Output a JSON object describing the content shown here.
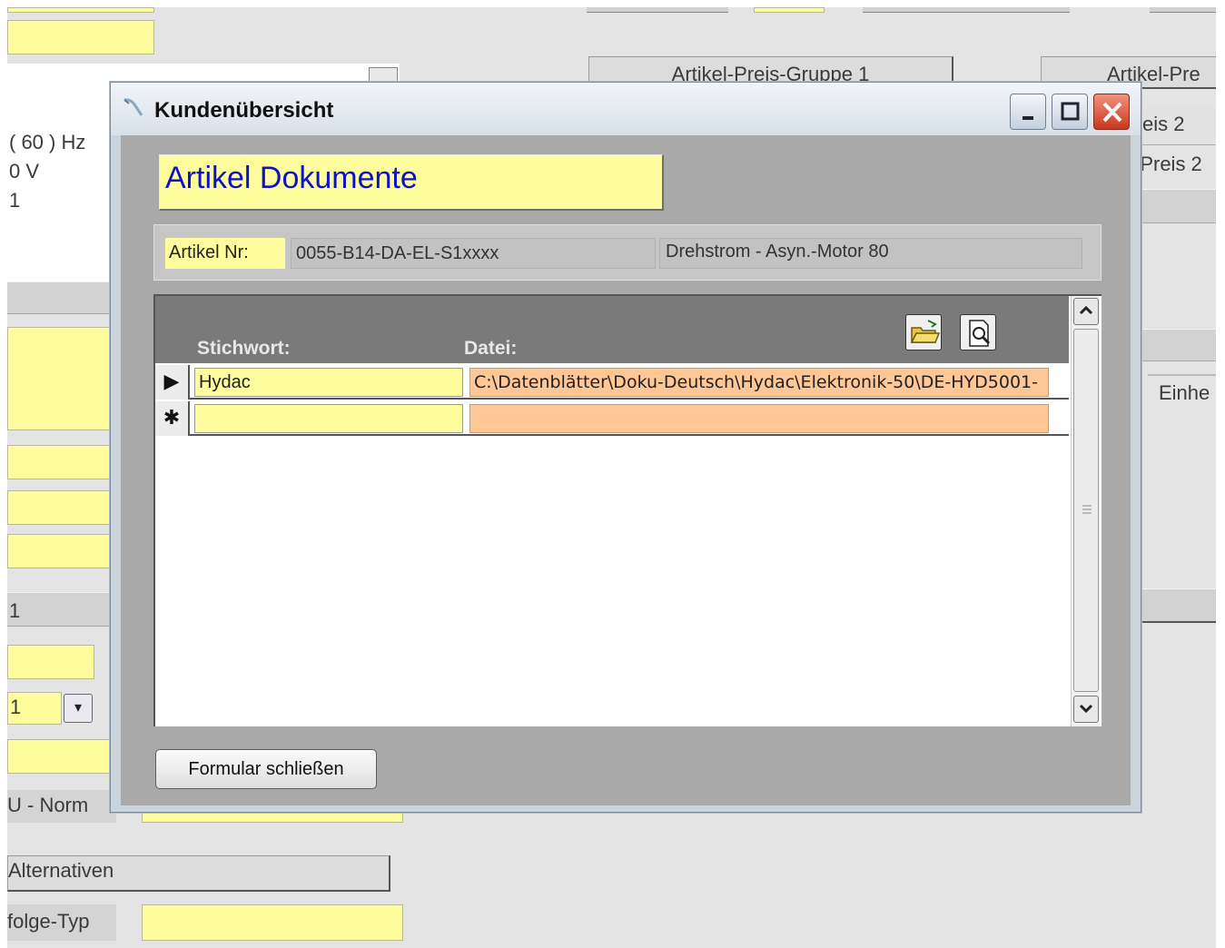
{
  "background": {
    "partial_labels": {
      "hz": "( 60 ) Hz",
      "volt": "0 V",
      "n1": "1",
      "n2": "1",
      "norm": "U - Norm",
      "folge_typ": "folge-Typ",
      "dropdown_value": "1",
      "preis2a": "eis 2",
      "preis2b": "-Preis 2",
      "einheit": "Einhe"
    },
    "tabs": {
      "group1": "Artikel-Preis-Gruppe 1",
      "group2": "Artikel-Pre"
    },
    "buttons": {
      "alternativen": "Alternativen"
    }
  },
  "window": {
    "title": "Kundenübersicht",
    "controls": {
      "minimize": "-",
      "maximize": "□",
      "close": "✕"
    }
  },
  "form": {
    "heading": "Artikel Dokumente",
    "article": {
      "label": "Artikel Nr:",
      "number": "0055-B14-DA-EL-S1xxxx",
      "description": "Drehstrom - Asyn.-Motor 80"
    },
    "columns": {
      "keyword": "Stichwort:",
      "file": "Datei:"
    },
    "rows": [
      {
        "selector": "▶",
        "keyword": "Hydac",
        "file": "C:\\Datenblätter\\Doku-Deutsch\\Hydac\\Elektronik-50\\DE-HYD5001-"
      },
      {
        "selector": "✱",
        "keyword": "",
        "file": ""
      }
    ],
    "close_button": "Formular schließen"
  },
  "colors": {
    "field_yellow": "#fdfd9e",
    "field_orange": "#ffc796",
    "heading_blue": "#1010c8",
    "window_frame": "#c9d4dd",
    "close_red": "#c9381f"
  },
  "icons": {
    "window": "app-window-icon",
    "open_folder": "open-folder-icon",
    "preview": "document-preview-icon"
  }
}
